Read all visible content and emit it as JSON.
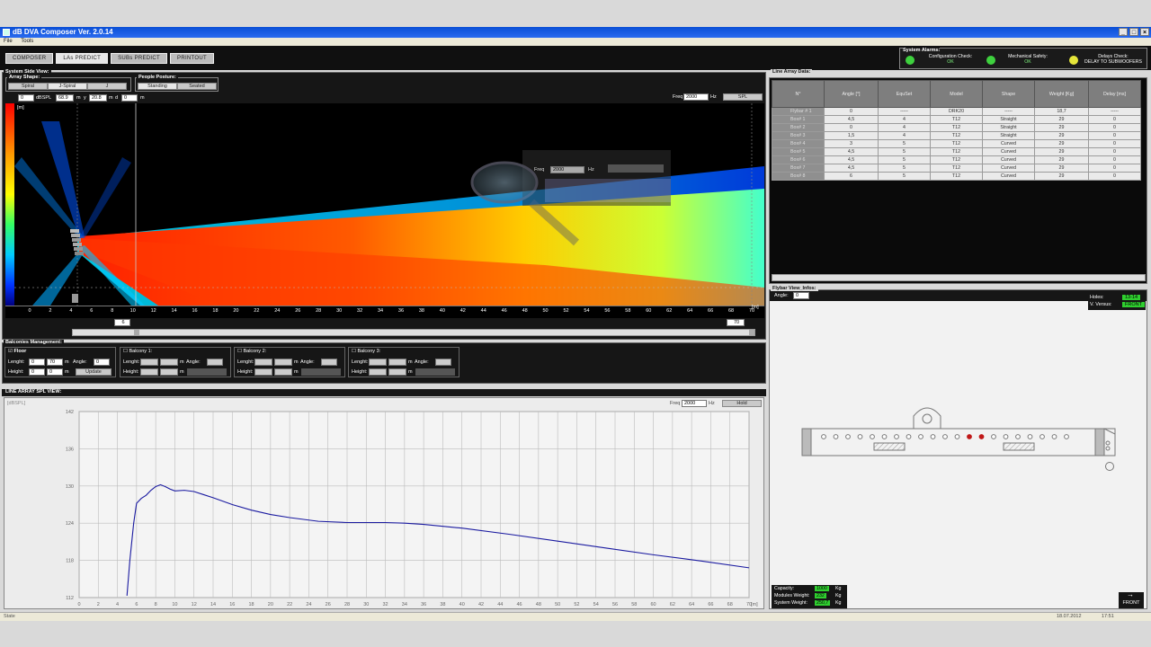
{
  "window": {
    "title": "dB DVA Composer Ver. 2.0.14"
  },
  "menu": [
    "File",
    "Tools"
  ],
  "tabs": [
    {
      "label": "COMPOSER",
      "active": false
    },
    {
      "label": "LAs PREDICT",
      "active": true
    },
    {
      "label": "SUBs PREDICT",
      "active": false
    },
    {
      "label": "PRINTOUT",
      "active": false
    }
  ],
  "alarms": {
    "title": "System Alarms:",
    "config": {
      "label": "Configuration Check:",
      "value": "OK",
      "color": "#3ed13e"
    },
    "mech": {
      "label": "Mechanical Safety:",
      "value": "OK",
      "color": "#3ed13e"
    },
    "delays": {
      "label": "Delays Check:",
      "value": "DELAY TO SUBWOOFERS",
      "color": "#e6e63a"
    }
  },
  "side_view": {
    "title": "System Side View:",
    "array_shape": {
      "title": "Array Shape:",
      "options": [
        "Spiral",
        "J-Spiral",
        "J"
      ],
      "selected": "J-Spiral"
    },
    "posture": {
      "title": "People Posture:",
      "options": [
        "Standing",
        "Seated"
      ],
      "selected": "Standing"
    },
    "readout": {
      "v1": "0",
      "unit1": "dBSPL",
      "v2": "68.9",
      "m1": "m",
      "y_label": "y",
      "v3": "20.8",
      "m2": "m",
      "d_label": "d",
      "v4": "0",
      "m3": "m"
    },
    "freq_label": "Freq",
    "freq_value": "2000",
    "freq_unit": "Hz",
    "spl_button": "SPL",
    "zoom": {
      "freq_label": "Freq",
      "freq_value": "2000",
      "freq_unit": "Hz"
    },
    "axis_unit": "[m]",
    "x_ticks": [
      "0",
      "2",
      "4",
      "6",
      "8",
      "10",
      "12",
      "14",
      "16",
      "18",
      "20",
      "22",
      "24",
      "26",
      "28",
      "30",
      "32",
      "34",
      "36",
      "38",
      "40",
      "42",
      "44",
      "46",
      "48",
      "50",
      "52",
      "54",
      "56",
      "58",
      "60",
      "62",
      "64",
      "66",
      "68",
      "70"
    ],
    "axis_end_label": "[m]",
    "scroll_left": "6",
    "scroll_right": "70"
  },
  "balconies": {
    "title": "Balconies Management:",
    "floor": {
      "label": "Floor",
      "length_label": "Lenght:",
      "length_a": "0",
      "length_b": "70",
      "m": "m",
      "angle_label": "Angle:",
      "angle": "0",
      "height_label": "Height:",
      "height_a": "0",
      "height_b": "0",
      "update": "Update"
    },
    "b1": {
      "label": "Balcony 1:",
      "length_label": "Lenght:",
      "height_label": "Height:",
      "m": "m",
      "angle_label": "Angle:"
    },
    "b2": {
      "label": "Balcony 2:",
      "length_label": "Lenght:",
      "height_label": "Height:",
      "m": "m",
      "angle_label": "Angle:"
    },
    "b3": {
      "label": "Balcony 3:",
      "length_label": "Lenght:",
      "height_label": "Height:",
      "m": "m",
      "angle_label": "Angle:"
    }
  },
  "spl_view": {
    "title": "LINE ARRAY SPL VIEW:",
    "freq_label": "Freq",
    "freq_value": "2000",
    "freq_unit": "Hz",
    "hold_button": "Hold",
    "ylabel": "[dBSPL]",
    "xlabel": "[m]"
  },
  "chart_data": {
    "type": "line",
    "title": "",
    "xlabel": "[m]",
    "ylabel": "[dBSPL]",
    "xlim": [
      0,
      70
    ],
    "ylim": [
      112,
      142
    ],
    "x_ticks": [
      0,
      2,
      4,
      6,
      8,
      10,
      12,
      14,
      16,
      18,
      20,
      22,
      24,
      26,
      28,
      30,
      32,
      34,
      36,
      38,
      40,
      42,
      44,
      46,
      48,
      50,
      52,
      54,
      56,
      58,
      60,
      62,
      64,
      66,
      68,
      70
    ],
    "y_ticks": [
      112,
      118,
      124,
      130,
      136,
      142
    ],
    "grid": true,
    "series": [
      {
        "color": "#1a1aa0",
        "x": [
          5.0,
          5.3,
          5.7,
          6.0,
          6.5,
          7.0,
          7.5,
          8.0,
          8.5,
          9.0,
          9.5,
          10.0,
          11.0,
          12.0,
          13.0,
          14.0,
          16.0,
          18.0,
          20.0,
          22.0,
          25.0,
          28.0,
          30.0,
          32.0,
          34.0,
          36.0,
          40.0,
          45.0,
          50.0,
          55.0,
          60.0,
          65.0,
          70.0
        ],
        "y": [
          112.3,
          118.0,
          124.0,
          127.2,
          128.0,
          128.5,
          129.3,
          129.9,
          130.2,
          129.9,
          129.5,
          129.2,
          129.3,
          129.1,
          128.6,
          128.1,
          127.0,
          126.1,
          125.4,
          124.9,
          124.3,
          124.1,
          124.1,
          124.1,
          124.0,
          123.8,
          123.2,
          122.2,
          121.1,
          120.0,
          118.9,
          117.9,
          116.8
        ]
      }
    ]
  },
  "line_array": {
    "title": "Line Array Data:",
    "headers": [
      "N°",
      "Angle [°]",
      "EquSet",
      "Model",
      "Shape",
      "Weight [Kg]",
      "Delay [ms]"
    ],
    "rows": [
      [
        "Flybar # 1",
        "0",
        "-----",
        "DRK20",
        "-----",
        "18,7",
        "-----"
      ],
      [
        "Box# 1",
        "4,5",
        "4",
        "T12",
        "Straight",
        "29",
        "0"
      ],
      [
        "Box# 2",
        "0",
        "4",
        "T12",
        "Straight",
        "29",
        "0"
      ],
      [
        "Box# 3",
        "1,5",
        "4",
        "T12",
        "Straight",
        "29",
        "0"
      ],
      [
        "Box# 4",
        "3",
        "5",
        "T12",
        "Curved",
        "29",
        "0"
      ],
      [
        "Box# 5",
        "4,5",
        "5",
        "T12",
        "Curved",
        "29",
        "0"
      ],
      [
        "Box# 6",
        "4,5",
        "5",
        "T12",
        "Curved",
        "29",
        "0"
      ],
      [
        "Box# 7",
        "4,5",
        "5",
        "T12",
        "Curved",
        "29",
        "0"
      ],
      [
        "Box# 8",
        "6",
        "5",
        "T12",
        "Curved",
        "29",
        "0"
      ]
    ]
  },
  "flybar_view": {
    "title": "Flybar View_Infos:",
    "angle_label": "Angle:",
    "angle_value": "0",
    "holes_label": "Holes:",
    "holes_value": "13-14",
    "vversus_label": "V. Versus:",
    "vversus_value": "FRONT",
    "capacity_label": "Capacity:",
    "capacity_value": "1000",
    "capacity_unit": "Kg",
    "modules_label": "Modules Weight:",
    "modules_value": "232",
    "modules_unit": "Kg",
    "system_label": "System Weight:",
    "system_value": "250,7",
    "system_unit": "Kg",
    "front_button": "FRONT"
  },
  "status": {
    "left": "State",
    "date": "18.07.2012",
    "time": "17:51"
  }
}
